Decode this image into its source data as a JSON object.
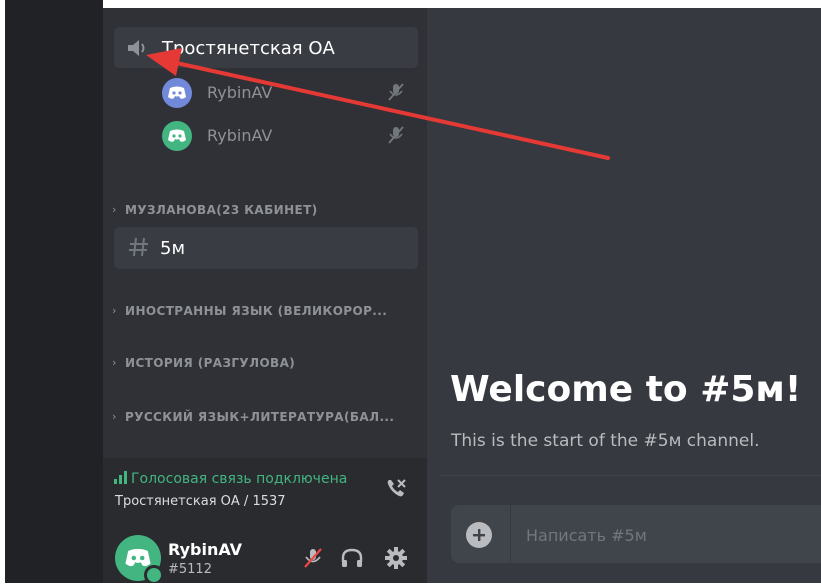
{
  "voice_channel": {
    "name": "Тростянетская ОА",
    "members": [
      {
        "name": "RybinAV",
        "avatar_color": "#7289da"
      },
      {
        "name": "RybinAV",
        "avatar_color": "#43b581"
      }
    ]
  },
  "categories": [
    {
      "label": "МУЗЛАНОВА(23 КАБИНЕТ)"
    },
    {
      "label": "ИНОСТРАННЫ ЯЗЫК (ВЕЛИКОРОР..."
    },
    {
      "label": "ИСТОРИЯ (РАЗГУЛОВА)"
    },
    {
      "label": "РУССКИЙ ЯЗЫК+ЛИТЕРАТУРА(БАЛ..."
    }
  ],
  "text_channel": {
    "name": "5м"
  },
  "voice_connection": {
    "status": "Голосовая связь подключена",
    "channel": "Тростянетская ОА / 1537"
  },
  "user": {
    "name": "RybinAV",
    "tag": "#5112"
  },
  "welcome": {
    "title": "Welcome to #5м!",
    "subtitle": "This is the start of the #5м channel."
  },
  "composer": {
    "placeholder": "Написать #5м"
  },
  "colors": {
    "accent_green": "#43b581",
    "blurple": "#7289da",
    "annotation_red": "#e53935"
  }
}
